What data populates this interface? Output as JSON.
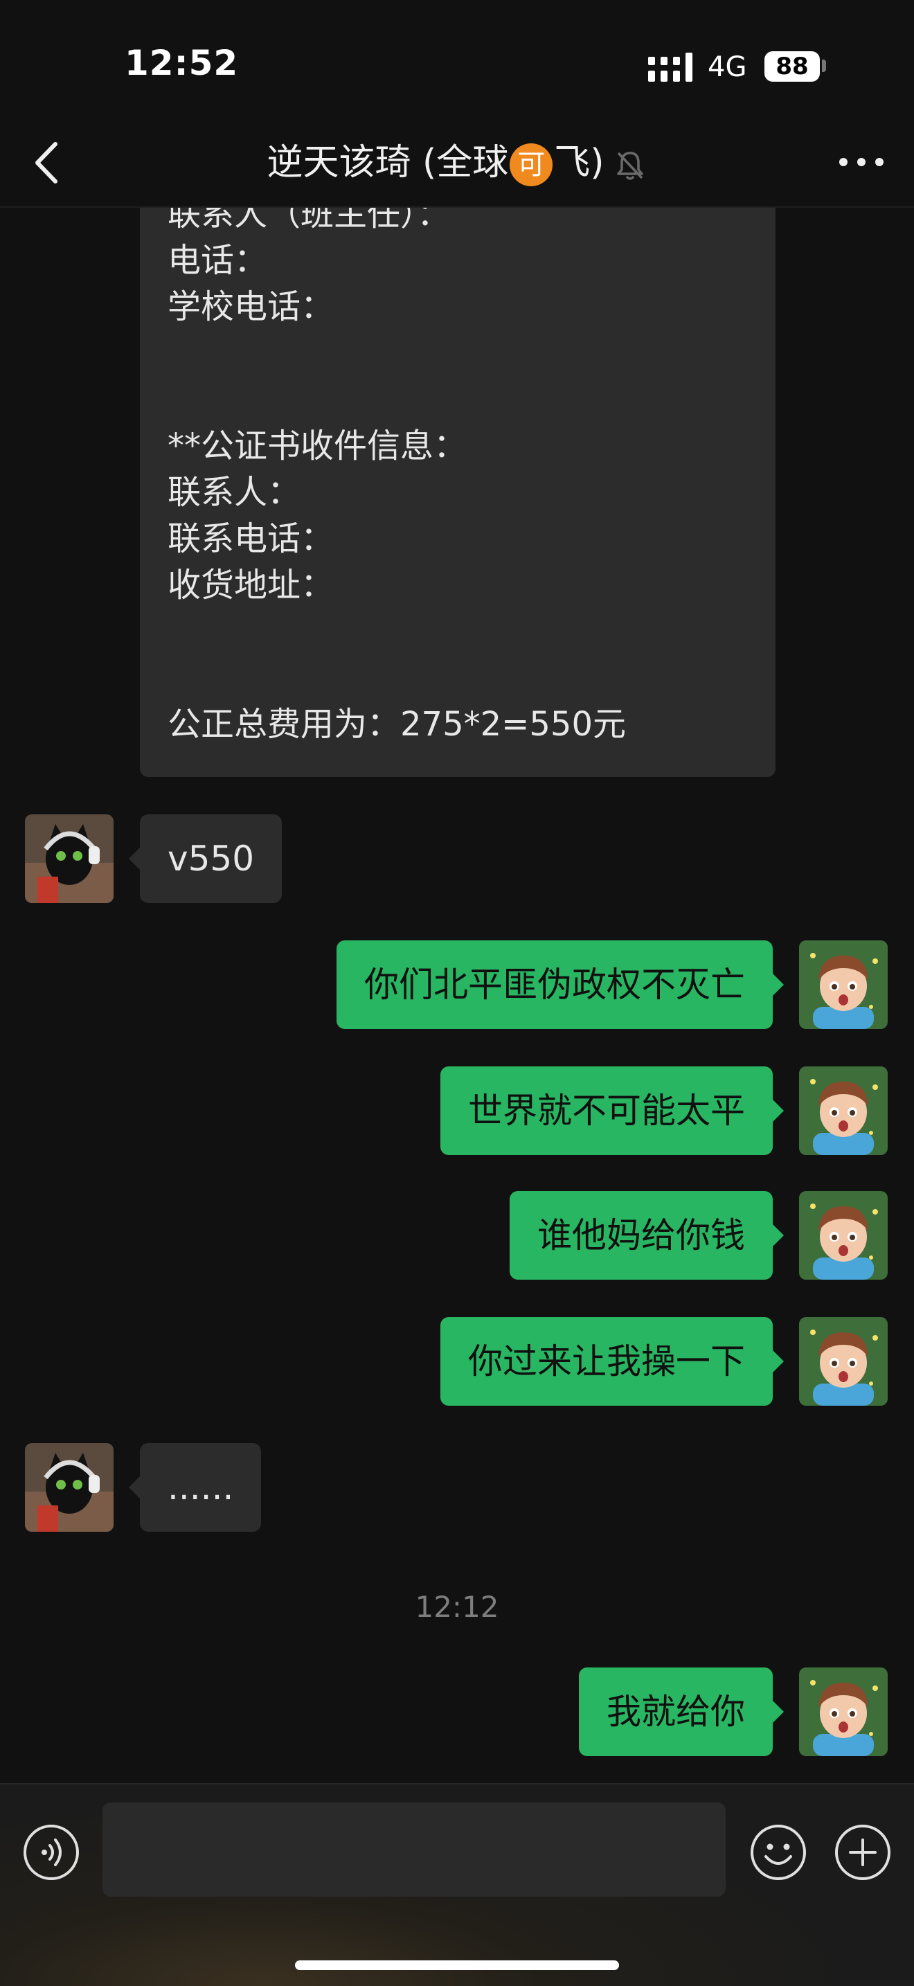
{
  "status_bar": {
    "time": "12:52",
    "network": "4G",
    "battery": "88"
  },
  "header": {
    "title_before": "逆天该琦 (全球",
    "title_badge": "可",
    "title_after": "飞)",
    "icons": {
      "back": "chevron-left-icon",
      "mute": "bell-off-icon",
      "more": "more-dots-icon"
    }
  },
  "messages": [
    {
      "side": "in",
      "lines": [
        "联系人（班主任）：",
        "电话：",
        "学校电话：",
        "",
        "",
        "**公证书收件信息：",
        "联系人：",
        "联系电话：",
        "收货地址：",
        "",
        "",
        "公正总费用为：275*2=550元"
      ]
    },
    {
      "side": "in",
      "text": "v550"
    },
    {
      "side": "out",
      "text": "你们北平匪伪政权不灭亡"
    },
    {
      "side": "out",
      "text": "世界就不可能太平"
    },
    {
      "side": "out",
      "text": "谁他妈给你钱"
    },
    {
      "side": "out",
      "text": "你过来让我操一下"
    },
    {
      "side": "in",
      "text": "......"
    },
    {
      "side": "time",
      "text": "12:12"
    },
    {
      "side": "out",
      "text": "我就给你"
    }
  ],
  "input_bar": {
    "value": "",
    "icons": {
      "voice": "voice-icon",
      "emoji": "emoji-icon",
      "plus": "plus-icon"
    }
  },
  "colors": {
    "background": "#111111",
    "outgoing_bubble": "#29b662",
    "incoming_bubble": "#2c2c2c",
    "badge": "#f18a1e"
  }
}
